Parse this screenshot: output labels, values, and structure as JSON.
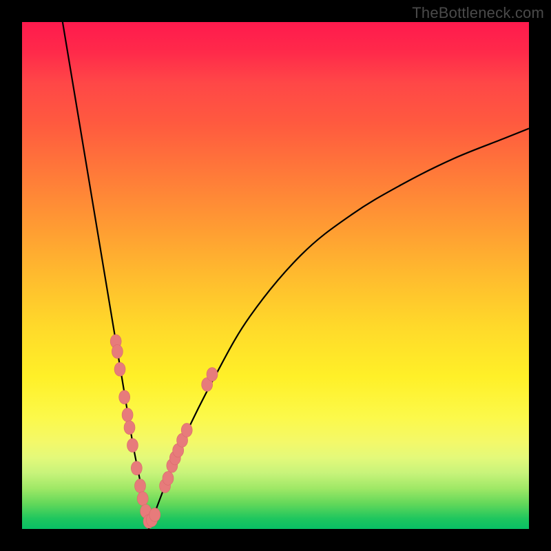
{
  "watermark": "TheBottleneck.com",
  "colors": {
    "curve_stroke": "#000000",
    "marker_fill": "#e77b7b",
    "marker_stroke": "#d86a6a",
    "background_frame": "#000000"
  },
  "chart_data": {
    "type": "line",
    "title": "",
    "xlabel": "",
    "ylabel": "",
    "xlim": [
      0,
      100
    ],
    "ylim": [
      0,
      100
    ],
    "note": "Bottleneck curve with optimum (minimum) near x≈25. Left branch descends steeply from y≈100 at x≈8 to y≈0 at x≈25; right branch rises with decreasing slope toward y≈80 at x=100.",
    "series": [
      {
        "name": "bottleneck-curve-left",
        "x": [
          8,
          10,
          12,
          14,
          16,
          18,
          20,
          22,
          24,
          25
        ],
        "y": [
          100,
          88,
          76,
          64,
          52,
          40,
          28,
          16,
          6,
          0
        ]
      },
      {
        "name": "bottleneck-curve-right",
        "x": [
          25,
          28,
          32,
          38,
          45,
          55,
          65,
          75,
          85,
          95,
          100
        ],
        "y": [
          0,
          8,
          18,
          30,
          42,
          54,
          62,
          68,
          73,
          77,
          79
        ]
      }
    ],
    "markers": {
      "name": "sample-points",
      "points": [
        {
          "x": 18.5,
          "y": 37
        },
        {
          "x": 18.8,
          "y": 35
        },
        {
          "x": 19.3,
          "y": 31.5
        },
        {
          "x": 20.2,
          "y": 26
        },
        {
          "x": 20.8,
          "y": 22.5
        },
        {
          "x": 21.2,
          "y": 20
        },
        {
          "x": 21.8,
          "y": 16.5
        },
        {
          "x": 22.6,
          "y": 12
        },
        {
          "x": 23.3,
          "y": 8.5
        },
        {
          "x": 23.8,
          "y": 6
        },
        {
          "x": 24.4,
          "y": 3.5
        },
        {
          "x": 25.0,
          "y": 1.5
        },
        {
          "x": 25.6,
          "y": 1.8
        },
        {
          "x": 26.2,
          "y": 2.8
        },
        {
          "x": 28.2,
          "y": 8.5
        },
        {
          "x": 28.8,
          "y": 10
        },
        {
          "x": 29.6,
          "y": 12.5
        },
        {
          "x": 30.2,
          "y": 14
        },
        {
          "x": 30.8,
          "y": 15.5
        },
        {
          "x": 31.6,
          "y": 17.5
        },
        {
          "x": 32.5,
          "y": 19.5
        },
        {
          "x": 36.5,
          "y": 28.5
        },
        {
          "x": 37.5,
          "y": 30.5
        }
      ]
    }
  }
}
